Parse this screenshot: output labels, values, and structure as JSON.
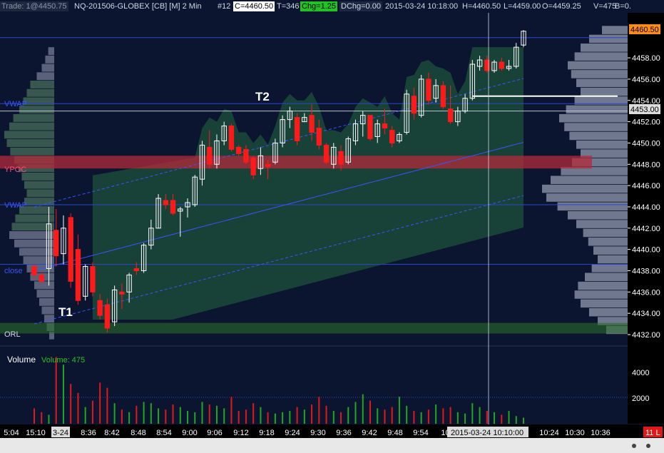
{
  "header": {
    "trade": "Trade: 1@4450.75",
    "symbol": "NQ-201506-GLOBEX [CB] [M]  2 Min",
    "bar_no": "#12",
    "close": "C=4460.50",
    "tick": "T=346",
    "chg": "Chg=1.25",
    "dchg": "DChg=0.00",
    "datetime": "2015-03-24 10:18:00",
    "high": "H=4460.50",
    "low": "L=4459.00",
    "open": "O=4459.25",
    "vol": "V=475",
    "tail": "B=0."
  },
  "price_labels": {
    "last": "4460.50",
    "cursor": "4453.00"
  },
  "level_labels": {
    "vwap1": "VWAP",
    "ypoc": "YPOC",
    "vwap2": "VWAP",
    "close": "close",
    "orl": "ORL"
  },
  "annotations": {
    "t1": "T1",
    "t2": "T2"
  },
  "volume_panel": {
    "title": "Volume",
    "value_label": "Volume: 475"
  },
  "time_cursor_label": "2015-03-24  10:10:00",
  "bars_badge": "11 L",
  "colors": {
    "background": "#0b1530",
    "up_candle": "#ffffff",
    "down_candle": "#ff1a1a",
    "value_area": "#1b4a3a",
    "ypoc_band": "#b22a3a",
    "profile": "#9aa3b8",
    "vwap": "#3b55ff",
    "level_line": "#2a46c8",
    "axis_text": "#ffffff"
  },
  "chart_data": {
    "type": "candlestick",
    "y_axis": {
      "min": 4431,
      "max": 4461,
      "ticks": [
        "4432.00",
        "4434.00",
        "4436.00",
        "4438.00",
        "4440.00",
        "4442.00",
        "4444.00",
        "4446.00",
        "4448.00",
        "4450.00",
        "4452.00",
        "4454.00",
        "4456.00",
        "4458.00"
      ]
    },
    "volume_axis": {
      "ticks": [
        "2000",
        "4000"
      ],
      "max": 5500
    },
    "x_labels": [
      "5:04",
      "15:10",
      "3-24",
      "8:36",
      "8:42",
      "8:48",
      "8:54",
      "9:00",
      "9:06",
      "9:12",
      "9:18",
      "9:24",
      "9:30",
      "9:36",
      "9:42",
      "9:48",
      "9:54",
      "10:",
      "10:24",
      "10:30",
      "10:36"
    ],
    "levels": {
      "vwap_prior": 4453.7,
      "ypoc": 4448.2,
      "vwap_lower": 4444.2,
      "close_prior": 4438.6,
      "orl": 4432.4,
      "cursor": 4453.0
    },
    "candles": [
      {
        "o": 4438.4,
        "h": 4438.6,
        "l": 4437.2,
        "c": 4437.6
      },
      {
        "o": 4437.6,
        "h": 4437.8,
        "l": 4436.8,
        "c": 4437.0
      },
      {
        "o": 4438.2,
        "h": 4444.0,
        "l": 4436.6,
        "c": 4442.4
      },
      {
        "o": 4441.8,
        "h": 4443.8,
        "l": 4438.4,
        "c": 4439.4
      },
      {
        "o": 4439.6,
        "h": 4443.2,
        "l": 4438.6,
        "c": 4442.0
      },
      {
        "o": 4443.0,
        "h": 4443.4,
        "l": 4436.4,
        "c": 4437.0
      },
      {
        "o": 4440.0,
        "h": 4441.4,
        "l": 4434.8,
        "c": 4435.2
      },
      {
        "o": 4435.6,
        "h": 4438.6,
        "l": 4435.2,
        "c": 4438.4
      },
      {
        "o": 4438.4,
        "h": 4438.8,
        "l": 4435.6,
        "c": 4436.0
      },
      {
        "o": 4435.2,
        "h": 4435.8,
        "l": 4433.4,
        "c": 4433.8
      },
      {
        "o": 4434.8,
        "h": 4435.4,
        "l": 4432.2,
        "c": 4432.6
      },
      {
        "o": 4433.2,
        "h": 4436.6,
        "l": 4432.8,
        "c": 4436.2
      },
      {
        "o": 4436.0,
        "h": 4436.8,
        "l": 4434.4,
        "c": 4435.8
      },
      {
        "o": 4436.0,
        "h": 4437.8,
        "l": 4435.0,
        "c": 4437.6
      },
      {
        "o": 4438.2,
        "h": 4438.8,
        "l": 4437.6,
        "c": 4438.0
      },
      {
        "o": 4438.0,
        "h": 4440.6,
        "l": 4437.8,
        "c": 4440.4
      },
      {
        "o": 4440.4,
        "h": 4442.8,
        "l": 4440.0,
        "c": 4442.0
      },
      {
        "o": 4442.0,
        "h": 4445.2,
        "l": 4442.0,
        "c": 4444.8
      },
      {
        "o": 4444.6,
        "h": 4445.2,
        "l": 4443.8,
        "c": 4444.2
      },
      {
        "o": 4444.6,
        "h": 4445.2,
        "l": 4443.2,
        "c": 4443.4
      },
      {
        "o": 4443.6,
        "h": 4444.0,
        "l": 4441.2,
        "c": 4443.8
      },
      {
        "o": 4444.0,
        "h": 4444.8,
        "l": 4443.0,
        "c": 4444.4
      },
      {
        "o": 4444.2,
        "h": 4447.0,
        "l": 4444.0,
        "c": 4446.8
      },
      {
        "o": 4446.6,
        "h": 4450.2,
        "l": 4446.0,
        "c": 4449.8
      },
      {
        "o": 4449.6,
        "h": 4451.2,
        "l": 4447.6,
        "c": 4448.0
      },
      {
        "o": 4448.0,
        "h": 4450.8,
        "l": 4447.6,
        "c": 4450.2
      },
      {
        "o": 4450.2,
        "h": 4452.0,
        "l": 4449.8,
        "c": 4451.6
      },
      {
        "o": 4451.6,
        "h": 4451.8,
        "l": 4449.2,
        "c": 4449.4
      },
      {
        "o": 4449.6,
        "h": 4449.8,
        "l": 4448.8,
        "c": 4449.0
      },
      {
        "o": 4449.4,
        "h": 4449.8,
        "l": 4448.0,
        "c": 4448.2
      },
      {
        "o": 4448.6,
        "h": 4448.8,
        "l": 4446.6,
        "c": 4447.0
      },
      {
        "o": 4447.6,
        "h": 4449.6,
        "l": 4447.0,
        "c": 4448.8
      },
      {
        "o": 4448.0,
        "h": 4448.4,
        "l": 4446.6,
        "c": 4447.8
      },
      {
        "o": 4448.2,
        "h": 4450.4,
        "l": 4448.0,
        "c": 4450.0
      },
      {
        "o": 4450.0,
        "h": 4452.6,
        "l": 4449.6,
        "c": 4452.2
      },
      {
        "o": 4452.2,
        "h": 4453.4,
        "l": 4451.4,
        "c": 4453.0
      },
      {
        "o": 4452.4,
        "h": 4452.8,
        "l": 4449.8,
        "c": 4450.2
      },
      {
        "o": 4452.0,
        "h": 4452.8,
        "l": 4452.0,
        "c": 4452.4
      },
      {
        "o": 4452.6,
        "h": 4453.6,
        "l": 4450.2,
        "c": 4451.0
      },
      {
        "o": 4451.4,
        "h": 4452.2,
        "l": 4449.4,
        "c": 4449.8
      },
      {
        "o": 4449.8,
        "h": 4450.0,
        "l": 4448.0,
        "c": 4448.2
      },
      {
        "o": 4448.0,
        "h": 4450.0,
        "l": 4447.6,
        "c": 4449.6
      },
      {
        "o": 4449.2,
        "h": 4449.8,
        "l": 4447.4,
        "c": 4448.0
      },
      {
        "o": 4448.2,
        "h": 4450.6,
        "l": 4448.0,
        "c": 4450.4
      },
      {
        "o": 4450.2,
        "h": 4452.2,
        "l": 4449.8,
        "c": 4451.8
      },
      {
        "o": 4451.8,
        "h": 4453.0,
        "l": 4450.6,
        "c": 4452.6
      },
      {
        "o": 4452.6,
        "h": 4452.6,
        "l": 4450.2,
        "c": 4450.4
      },
      {
        "o": 4450.6,
        "h": 4452.2,
        "l": 4450.0,
        "c": 4451.8
      },
      {
        "o": 4451.8,
        "h": 4453.2,
        "l": 4450.8,
        "c": 4451.4
      },
      {
        "o": 4451.2,
        "h": 4451.6,
        "l": 4449.6,
        "c": 4450.0
      },
      {
        "o": 4450.2,
        "h": 4451.0,
        "l": 4450.0,
        "c": 4450.8
      },
      {
        "o": 4451.0,
        "h": 4455.0,
        "l": 4450.8,
        "c": 4454.6
      },
      {
        "o": 4454.4,
        "h": 4455.2,
        "l": 4452.2,
        "c": 4452.8
      },
      {
        "o": 4452.6,
        "h": 4456.4,
        "l": 4452.4,
        "c": 4456.0
      },
      {
        "o": 4456.0,
        "h": 4456.6,
        "l": 4453.6,
        "c": 4454.0
      },
      {
        "o": 4454.2,
        "h": 4456.0,
        "l": 4453.8,
        "c": 4455.4
      },
      {
        "o": 4455.4,
        "h": 4455.8,
        "l": 4453.2,
        "c": 4453.4
      },
      {
        "o": 4453.2,
        "h": 4455.4,
        "l": 4451.8,
        "c": 4452.0
      },
      {
        "o": 4452.0,
        "h": 4453.4,
        "l": 4451.6,
        "c": 4453.0
      },
      {
        "o": 4453.0,
        "h": 4454.6,
        "l": 4452.8,
        "c": 4454.2
      },
      {
        "o": 4454.2,
        "h": 4457.8,
        "l": 4454.0,
        "c": 4457.4
      },
      {
        "o": 4457.2,
        "h": 4458.2,
        "l": 4456.8,
        "c": 4457.8
      },
      {
        "o": 4457.8,
        "h": 4458.2,
        "l": 4456.6,
        "c": 4456.8
      },
      {
        "o": 4456.8,
        "h": 4457.8,
        "l": 4456.6,
        "c": 4457.6
      },
      {
        "o": 4457.6,
        "h": 4458.0,
        "l": 4456.8,
        "c": 4457.0
      },
      {
        "o": 4457.0,
        "h": 4457.8,
        "l": 4456.8,
        "c": 4457.2
      },
      {
        "o": 4457.2,
        "h": 4459.4,
        "l": 4457.0,
        "c": 4459.0
      },
      {
        "o": 4459.2,
        "h": 4460.6,
        "l": 4459.0,
        "c": 4460.5
      }
    ],
    "volume": [
      1200,
      900,
      700,
      5200,
      4600,
      3100,
      2400,
      1300,
      1800,
      3200,
      2800,
      1600,
      1100,
      900,
      1400,
      1700,
      1600,
      1200,
      1100,
      1500,
      1300,
      1000,
      900,
      1700,
      1500,
      1400,
      1200,
      2100,
      1000,
      1100,
      1600,
      1300,
      900,
      800,
      900,
      1000,
      1300,
      1100,
      1500,
      2100,
      1400,
      1000,
      900,
      1300,
      1700,
      2300,
      1800,
      1200,
      1100,
      1300,
      2100,
      1400,
      1000,
      900,
      1100,
      1500,
      1200,
      1300,
      900,
      800,
      1600,
      1300,
      1000,
      900,
      700,
      1000,
      600,
      475
    ],
    "volume_profile_left": [
      0.12,
      0.18,
      0.25,
      0.35,
      0.48,
      0.55,
      0.62,
      0.7,
      0.82,
      0.9,
      1.0,
      0.95,
      0.88,
      0.8,
      0.72,
      0.65,
      0.6,
      0.55,
      0.6,
      0.7,
      0.78,
      0.85,
      0.9,
      0.8,
      0.7,
      0.62,
      0.55,
      0.48,
      0.4,
      0.35,
      0.3,
      0.25,
      0.2,
      0.15,
      0.1
    ],
    "volume_profile_right": [
      0.3,
      0.45,
      0.55,
      0.62,
      0.7,
      0.66,
      0.6,
      0.55,
      0.62,
      0.72,
      0.8,
      0.74,
      0.68,
      0.6,
      0.55,
      0.65,
      0.78,
      0.9,
      1.0,
      0.95,
      0.82,
      0.7,
      0.6,
      0.52,
      0.46,
      0.4,
      0.35,
      0.42,
      0.5,
      0.58,
      0.62,
      0.55,
      0.45,
      0.35,
      0.25
    ]
  }
}
